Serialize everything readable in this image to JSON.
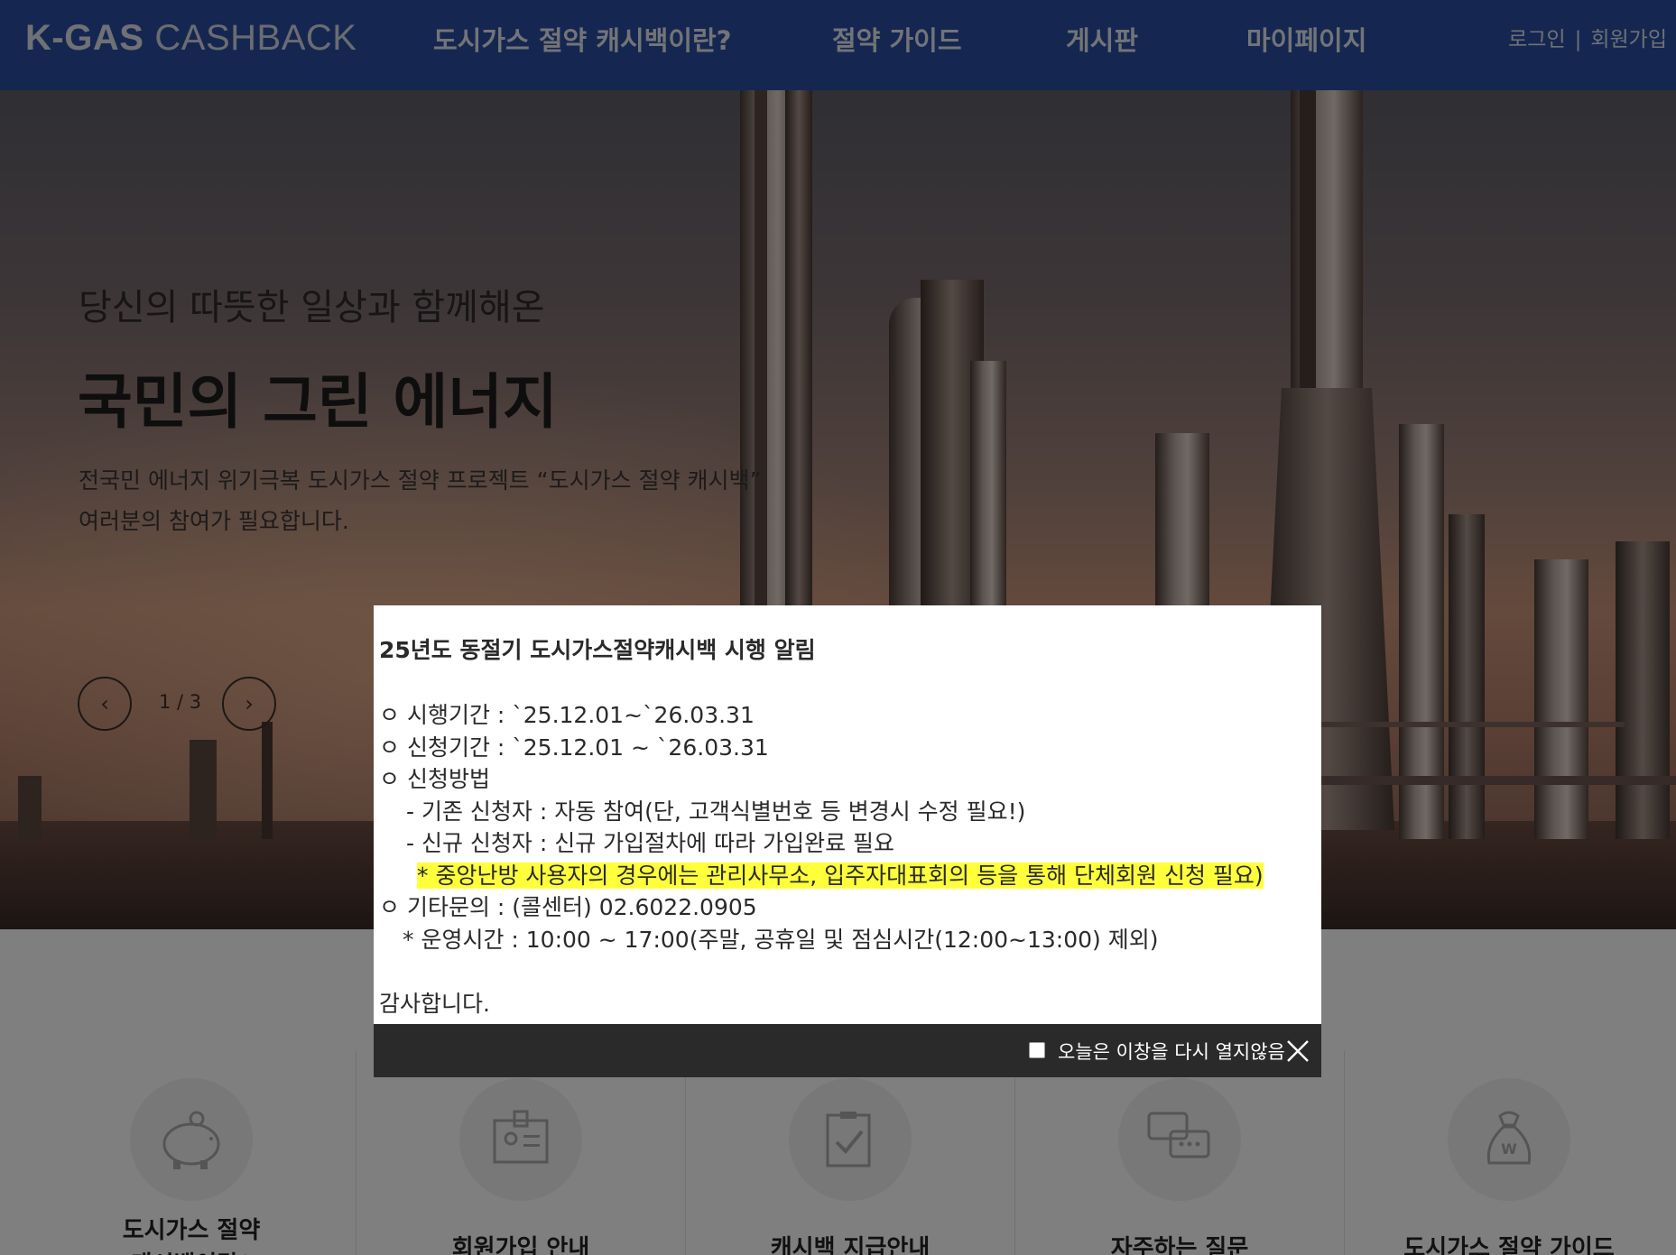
{
  "header": {
    "logo_strong": "K-GAS",
    "logo_thin": "CASHBACK",
    "nav": [
      {
        "label": "도시가스 절약 캐시백이란?"
      },
      {
        "label": "절약 가이드"
      },
      {
        "label": "게시판"
      },
      {
        "label": "마이페이지"
      }
    ],
    "login": "로그인",
    "separator": "|",
    "signup": "회원가입"
  },
  "hero": {
    "subtitle": "당신의 따뜻한 일상과 함께해온",
    "title": "국민의 그린 에너지",
    "desc_line1": "전국민 에너지 위기극복 도시가스 절약 프로젝트 “도시가스 절약 캐시백”",
    "desc_line2": "여러분의 참여가 필요합니다.",
    "pager": "1 / 3",
    "prev_icon": "‹",
    "next_icon": "›"
  },
  "quick_menu": [
    {
      "label_line1": "도시가스 절약",
      "label_line2": "캐시백이란?",
      "icon": "piggy-bank-icon"
    },
    {
      "label_line1": "회원가입 안내",
      "label_line2": "",
      "icon": "id-card-icon"
    },
    {
      "label_line1": "캐시백 지급안내",
      "label_line2": "",
      "icon": "clipboard-check-icon"
    },
    {
      "label_line1": "자주하는 질문",
      "label_line2": "",
      "icon": "chat-bubbles-icon"
    },
    {
      "label_line1": "도시가스 절약 가이드",
      "label_line2": "",
      "icon": "money-bag-icon"
    }
  ],
  "popup": {
    "title": "25년도 동절기 도시가스절약캐시백 시행 알림",
    "lines": {
      "period": "ㅇ 시행기간 : `25.12.01~`26.03.31",
      "apply_period": "ㅇ 신청기간 : `25.12.01 ~ `26.03.31",
      "method": "ㅇ 신청방법",
      "existing": "- 기존 신청자 : 자동 참여(단, 고객식별번호 등 변경시 수정 필요!)",
      "new": "- 신규 신청자 : 신규 가입절차에 따라 가입완료 필요",
      "central": "* 중앙난방 사용자의 경우에는 관리사무소, 입주자대표회의 등을 통해 단체회원 신청 필요)",
      "contact": "ㅇ 기타문의 : (콜센터) 02.6022.0905",
      "hours": "* 운영시간 : 10:00 ~ 17:00(주말, 공휴일 및 점심시간(12:00~13:00) 제외)",
      "thanks": "감사합니다."
    },
    "dont_show_today": "오늘은 이창을 다시 열지않음"
  },
  "colors": {
    "header_bg": "#2b4ea3",
    "highlight": "#ffff3b",
    "popup_footer": "#2a2a2a"
  }
}
